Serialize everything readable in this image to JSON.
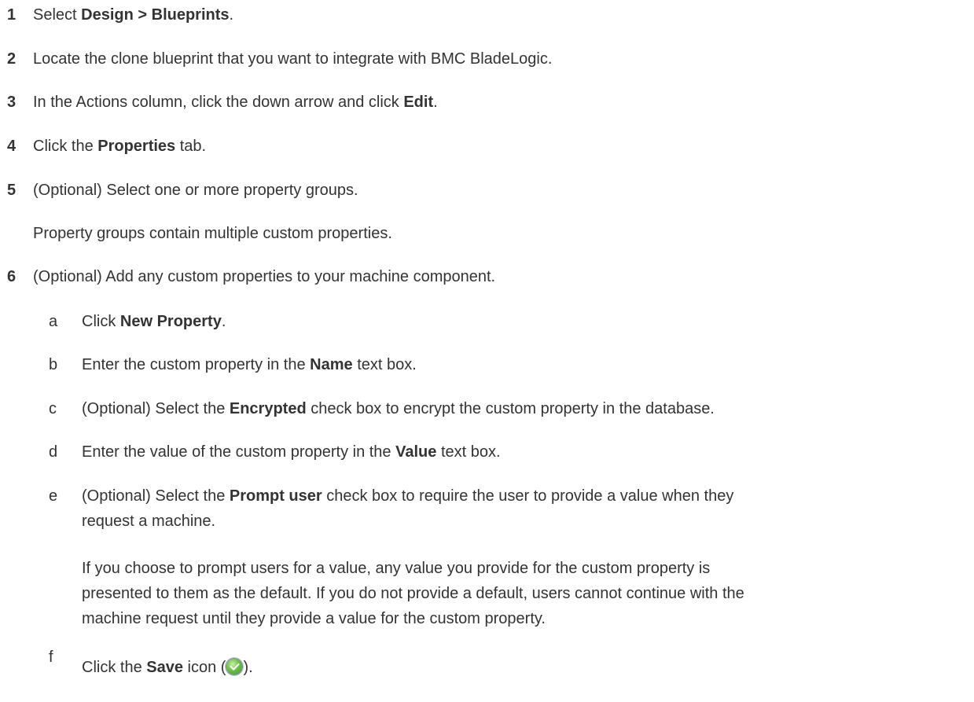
{
  "steps": [
    {
      "num": "1",
      "pre": "Select ",
      "bold": "Design > Blueprints",
      "post": "."
    },
    {
      "num": "2",
      "text": "Locate the clone blueprint that you want to integrate with BMC BladeLogic."
    },
    {
      "num": "3",
      "pre": "In the Actions column, click the down arrow and click ",
      "bold": "Edit",
      "post": "."
    },
    {
      "num": "4",
      "pre": "Click the ",
      "bold": "Properties",
      "post": " tab."
    },
    {
      "num": "5",
      "text": "(Optional) Select one or more property groups.",
      "note": "Property groups contain multiple custom properties."
    },
    {
      "num": "6",
      "text": "(Optional) Add any custom properties to your machine component."
    }
  ],
  "substeps": [
    {
      "letter": "a",
      "pre": "Click ",
      "bold": "New Property",
      "post": "."
    },
    {
      "letter": "b",
      "pre": "Enter the custom property in the ",
      "bold": "Name",
      "post": " text box."
    },
    {
      "letter": "c",
      "pre": "(Optional) Select the ",
      "bold": "Encrypted",
      "post": " check box to encrypt the custom property in the database."
    },
    {
      "letter": "d",
      "pre": "Enter the value of the custom property in the ",
      "bold": "Value",
      "post": " text box."
    },
    {
      "letter": "e",
      "pre": "(Optional) Select the ",
      "bold": "Prompt user",
      "post1": " check box to require the user to provide a value when they",
      "post2": "request a machine."
    },
    {
      "letter": "f",
      "pre": "Click the ",
      "bold": "Save",
      "post_a": " icon (",
      "post_b": ")."
    }
  ],
  "paragraph": {
    "line1": "If you choose to prompt users for a value, any value you provide for the custom property is",
    "line2": "presented to them as the default. If you do not provide a default, users cannot continue with the",
    "line3": "machine request until they provide a value for the custom property."
  },
  "icons": {
    "save": "save-check-icon",
    "save_color": "#5cb83c"
  }
}
